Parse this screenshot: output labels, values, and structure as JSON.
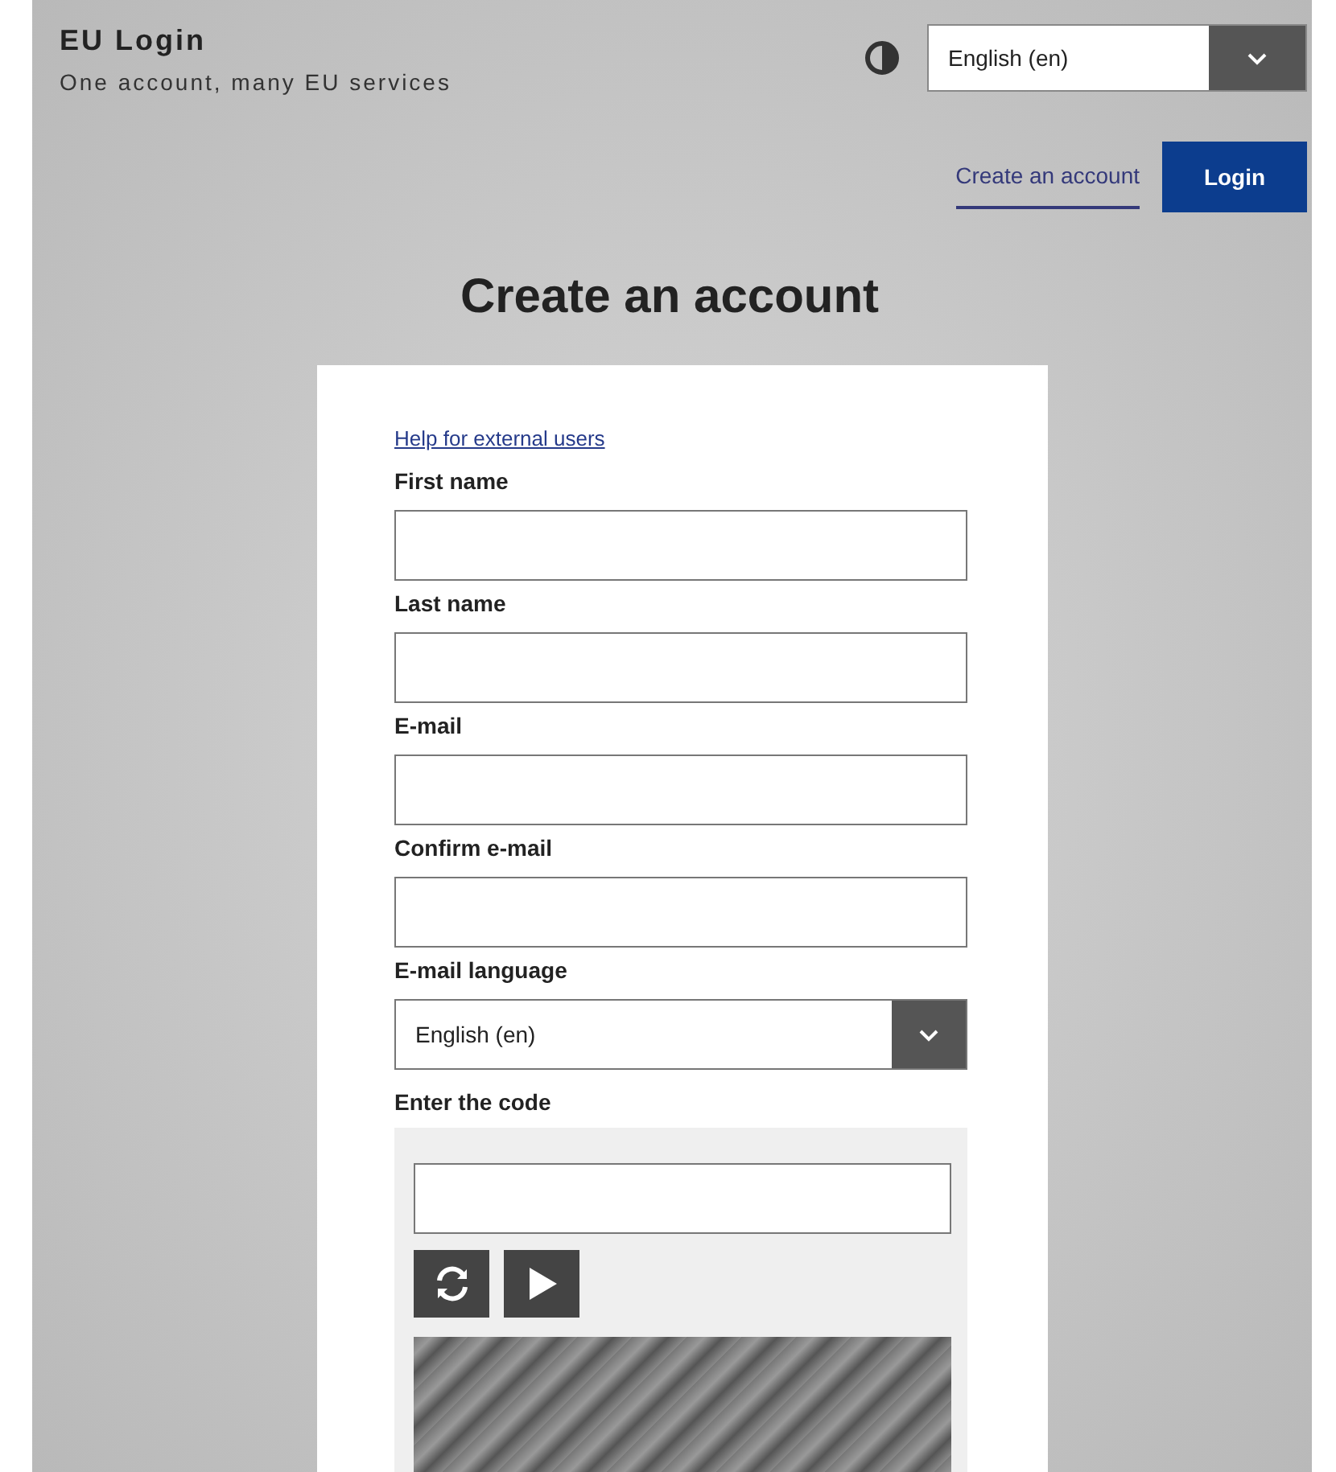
{
  "header": {
    "title": "EU Login",
    "subtitle": "One account, many EU services",
    "language_select": {
      "value": "English (en)"
    },
    "create_account_link": "Create an account",
    "login_button": "Login"
  },
  "page_title": "Create an account",
  "form": {
    "help_link": "Help for external users",
    "fields": [
      {
        "label": "First name"
      },
      {
        "label": "Last name"
      },
      {
        "label": "E-mail"
      },
      {
        "label": "Confirm e-mail"
      }
    ],
    "email_language": {
      "label": "E-mail language",
      "value": "English (en)"
    },
    "captcha": {
      "label": "Enter the code"
    }
  }
}
